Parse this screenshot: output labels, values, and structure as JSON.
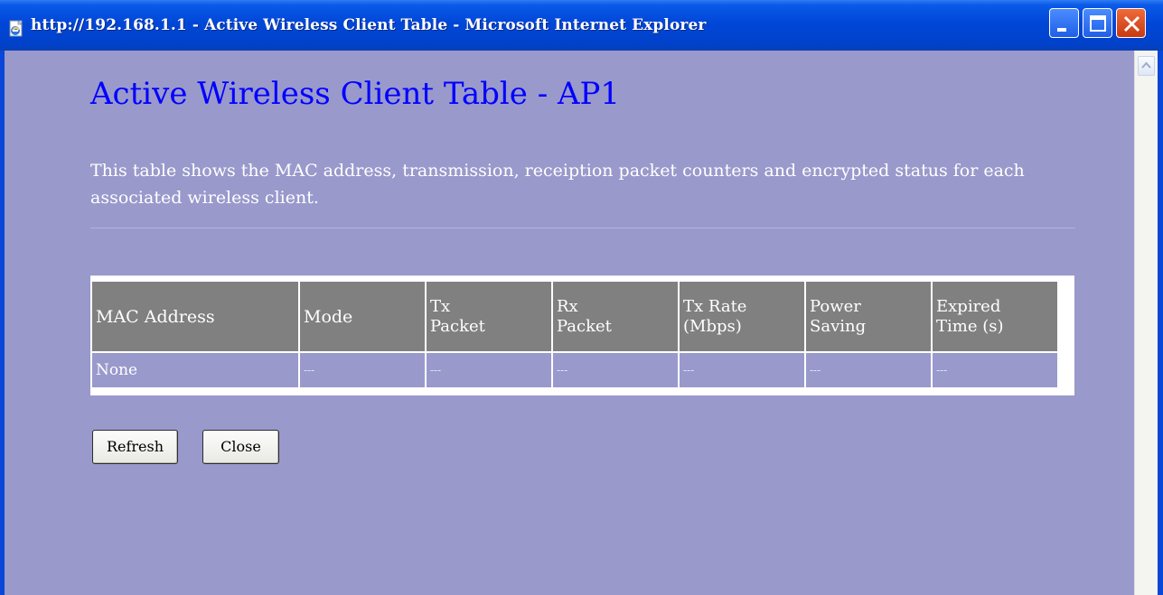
{
  "window": {
    "title": "http://192.168.1.1 - Active Wireless Client Table - Microsoft Internet Explorer",
    "icon": "ie-page-icon",
    "controls": [
      "minimize-icon",
      "maximize-icon",
      "close-icon"
    ]
  },
  "page": {
    "title": "Active Wireless Client Table - AP1",
    "description": "This table shows the MAC address, transmission, receiption packet counters and encrypted status for each associated wireless client."
  },
  "table": {
    "headers": [
      [
        "MAC Address"
      ],
      [
        "Mode"
      ],
      [
        "Tx",
        "Packet"
      ],
      [
        "Rx",
        "Packet"
      ],
      [
        "Tx Rate",
        "(Mbps)"
      ],
      [
        "Power",
        "Saving"
      ],
      [
        "Expired",
        "Time (s)"
      ]
    ],
    "rows": [
      [
        "None",
        "---",
        "---",
        "---",
        "---",
        "---",
        "---"
      ]
    ]
  },
  "buttons": {
    "refresh": "Refresh",
    "close": "Close"
  },
  "colors": {
    "page_background": "#9999cc",
    "title_color": "#0000ff",
    "header_background": "#808080",
    "titlebar_blue": "#0047d8"
  }
}
